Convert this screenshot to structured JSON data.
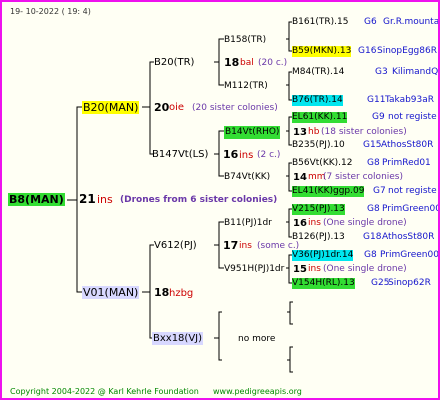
{
  "date": "19-  10-2022  ( 19:   4)",
  "root": {
    "name": "B8(MAN)",
    "num": "21",
    "code": "ins",
    "drones": "(Drones from 6 sister colonies)"
  },
  "gen1": {
    "top": {
      "name": "B20(MAN)",
      "num": "20",
      "code": "oie",
      "note": "(20 sister colonies)"
    },
    "bottom": {
      "name": "V01(MAN)",
      "num": "18",
      "code": "hzbg"
    }
  },
  "gen2": {
    "b20tr": {
      "name": "B20(TR)"
    },
    "b147": {
      "name": "B147Vt(LS)",
      "num": "16",
      "code": "ins",
      "note": "(2 c.)"
    },
    "v612": {
      "name": "V612(PJ)",
      "num": "17",
      "code": "ins",
      "note": "(some c.)"
    },
    "bxx18": {
      "name": "Bxx18(VJ)",
      "note": "no more"
    }
  },
  "gen3": {
    "b158": {
      "name": "B158(TR)",
      "num": "18",
      "code": "bal",
      "note": "(20 c.)"
    },
    "m112": {
      "name": "M112(TR)"
    },
    "b14vt": {
      "name": "B14Vt(RHO)",
      "num": "13",
      "code": "hb",
      "note": "(18 sister colonies)"
    },
    "b74vt": {
      "name": "B74Vt(KK)",
      "num": "14",
      "code": "mm",
      "note": "(7 sister colonies)"
    },
    "b11": {
      "name": "B11(PJ)1dr",
      "num": "16",
      "code": "ins",
      "note": "(One single drone)"
    },
    "v951h": {
      "name": "V951H(PJ)1dr",
      "num": "15",
      "code": "ins",
      "note": "(One single drone)"
    }
  },
  "gen4": [
    {
      "name": "B161(TR).15",
      "gen": "G6",
      "loc": "Gr.R.mounta"
    },
    {
      "name": "B59(MKN).13",
      "gen": "G16",
      "loc": "SinopEgg86R"
    },
    {
      "name": "M84(TR).14",
      "gen": "G3",
      "loc": "KilimandQ"
    },
    {
      "name": "B76(TR).14",
      "gen": "G11",
      "loc": "Takab93aR"
    },
    {
      "name": "EL61(KK).11",
      "gen": "G9",
      "loc": "not registe"
    },
    {
      "name": "B235(PJ).10",
      "gen": "G15",
      "loc": "AthosSt80R"
    },
    {
      "name": "B56Vt(KK).12",
      "gen": "G8",
      "loc": "PrimRed01"
    },
    {
      "name": "EL41(KK)ggp.09",
      "gen": "G7",
      "loc": "not registe"
    },
    {
      "name": "V215(PJ).13",
      "gen": "G8",
      "loc": "PrimGreen00"
    },
    {
      "name": "B126(PJ).13",
      "gen": "G18",
      "loc": "AthosSt80R"
    },
    {
      "name": "V36(PJ)1dr.14",
      "gen": "G8",
      "loc": "PrimGreen00"
    },
    {
      "name": "V154H(RL).13",
      "gen": "G25",
      "loc": "Sinop62R"
    }
  ],
  "footer": {
    "copyright": "Copyright 2004-2022 @ Karl Kehrle Foundation",
    "url": "www.pedigreeapis.org"
  },
  "colors": {
    "border": "#ee11ee",
    "yellow": "#ffff00",
    "green": "#33dd33",
    "cyan": "#00e6ee",
    "red": "#cc0000",
    "blue": "#1515cc"
  }
}
